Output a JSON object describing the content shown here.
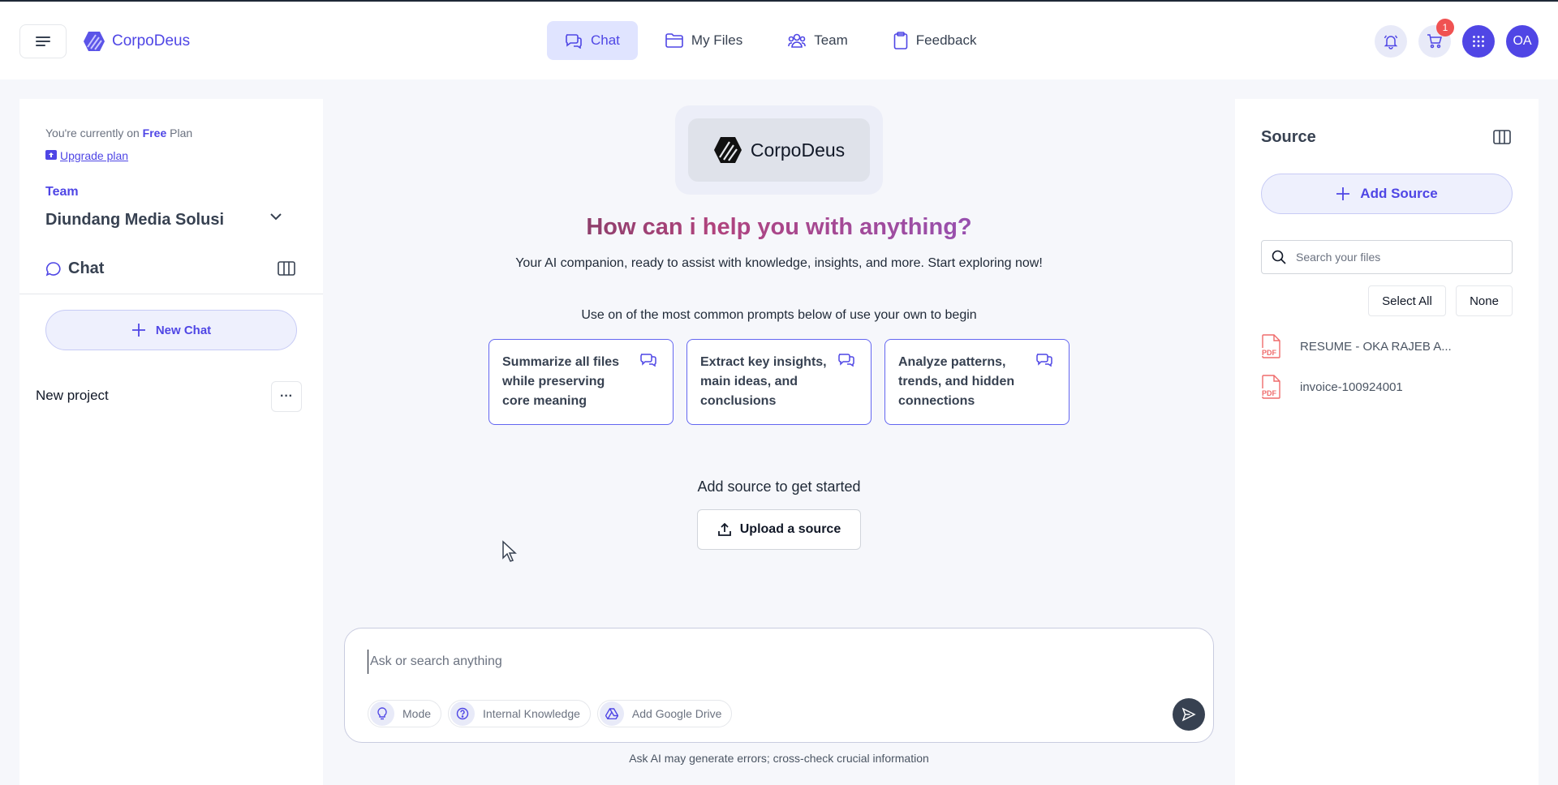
{
  "header": {
    "brand": "CorpoDeus",
    "nav": [
      {
        "label": "Chat",
        "icon": "chat-bubbles-icon",
        "active": true
      },
      {
        "label": "My Files",
        "icon": "folder-icon",
        "active": false
      },
      {
        "label": "Team",
        "icon": "team-icon",
        "active": false
      },
      {
        "label": "Feedback",
        "icon": "clipboard-icon",
        "active": false
      }
    ],
    "cart_badge": "1",
    "avatar_initials": "OA"
  },
  "sidebar": {
    "plan_prefix": "You're currently on ",
    "plan_name": "Free",
    "plan_suffix": " Plan",
    "upgrade_label": "Upgrade plan",
    "team_label": "Team",
    "team_name": "Diundang Media Solusi",
    "chat_title": "Chat",
    "new_chat_label": "New Chat",
    "project_name": "New project",
    "project_more": "···"
  },
  "main": {
    "logo_text": "CorpoDeus",
    "headline": "How can i help you with anything?",
    "subline": "Your AI companion, ready to assist with knowledge, insights, and more. Start exploring now!",
    "prompt_hint": "Use on of the most common prompts below of use your own to begin",
    "prompts": [
      "Summarize all files while preserving core meaning",
      "Extract key insights, main ideas, and conclusions",
      "Analyze patterns, trends, and hidden connections"
    ],
    "add_source_hint": "Add source to get started",
    "upload_label": "Upload a source",
    "composer_placeholder": "Ask or search anything",
    "chips": [
      "Mode",
      "Internal Knowledge",
      "Add Google Drive"
    ],
    "disclaimer": "Ask AI may generate errors; cross-check crucial information"
  },
  "source_panel": {
    "title": "Source",
    "add_source_label": "Add Source",
    "search_placeholder": "Search your files",
    "select_all_label": "Select All",
    "none_label": "None",
    "files": [
      {
        "name": "RESUME - OKA RAJEB A...",
        "type": "PDF"
      },
      {
        "name": "invoice-100924001",
        "type": "PDF"
      }
    ]
  },
  "colors": {
    "accent": "#4f46e5",
    "accent_light": "#e0e4ff",
    "badge": "#f05252",
    "pdf": "#ef6b6b"
  }
}
